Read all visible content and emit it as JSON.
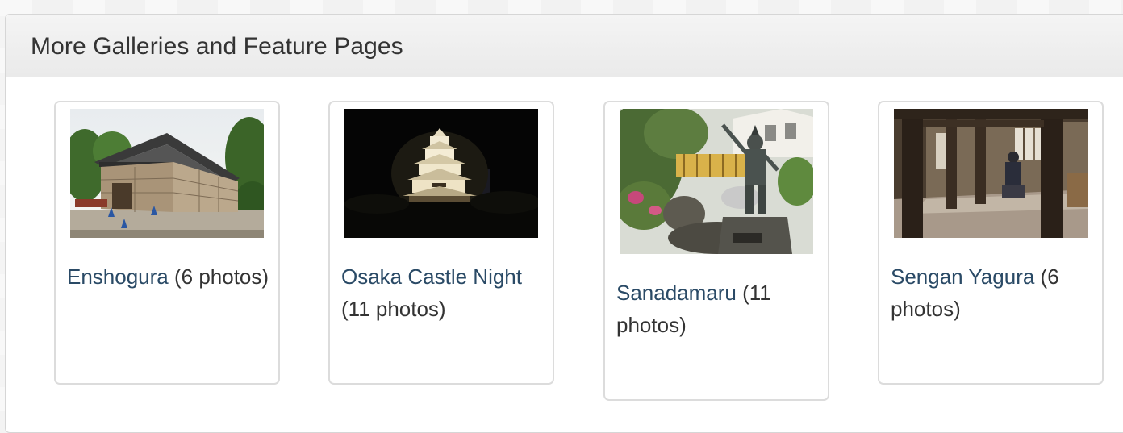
{
  "section": {
    "title": "More Galleries and Feature Pages"
  },
  "galleries": [
    {
      "name": "Enshogura",
      "count": " (6 photos)",
      "image": "stone-storehouse-photo"
    },
    {
      "name": "Osaka Castle Night",
      "count": " (11 photos)",
      "image": "castle-at-night-photo"
    },
    {
      "name": "Sanadamaru",
      "count": " (11 photos)",
      "image": "samurai-statue-photo"
    },
    {
      "name": "Sengan Yagura",
      "count": " (6 photos)",
      "image": "wooden-interior-photo"
    }
  ]
}
